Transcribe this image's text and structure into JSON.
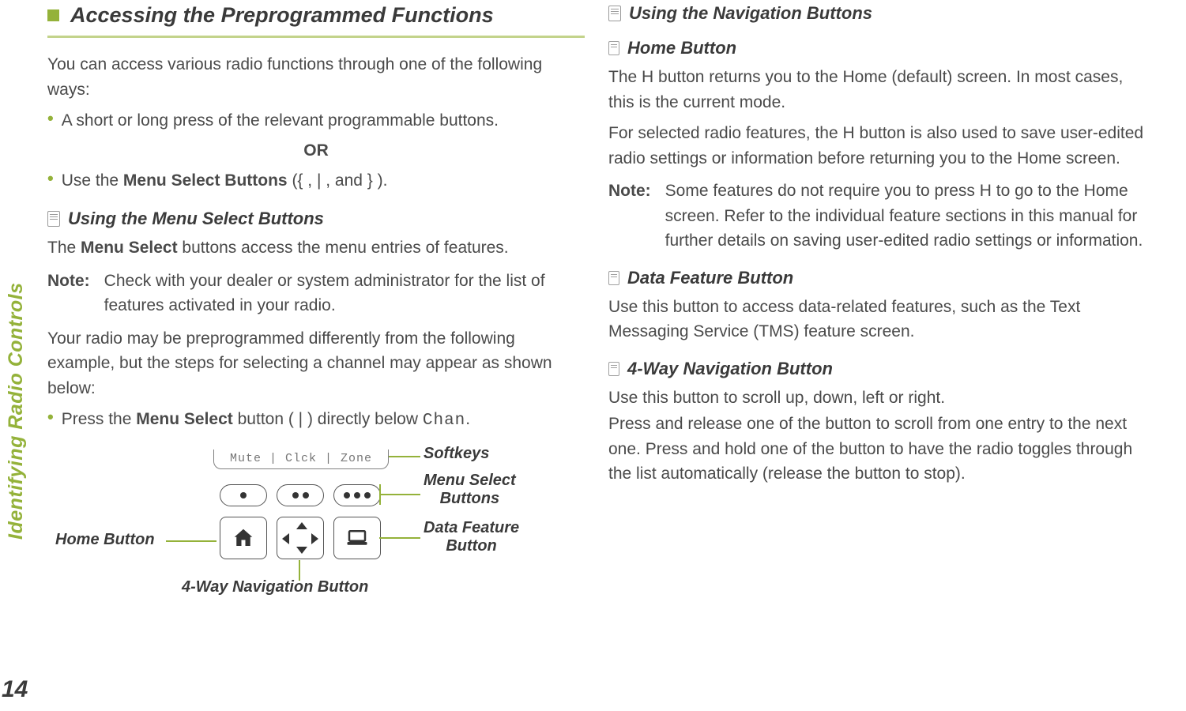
{
  "page": {
    "side_label": "Identifying Radio Controls",
    "number": "14"
  },
  "left": {
    "h1": "Accessing the Preprogrammed Functions",
    "intro": "You can access various radio functions through one of the following ways:",
    "bullet1": "A short or long press of the relevant programmable buttons.",
    "or": "OR",
    "bullet2_pre": "Use the ",
    "bullet2_bold": "Menu Select Buttons",
    "bullet2_post": " ({    , |    , and }    ).",
    "h2": "Using the Menu Select Buttons",
    "p1_pre": "The ",
    "p1_bold": "Menu Select",
    "p1_post": " buttons access the menu entries of features.",
    "note_label": "Note:",
    "note_body": "Check with your dealer or system administrator for the list of features activated in your radio.",
    "p2": "Your radio may be preprogrammed differently from the following example, but the steps for selecting a channel may appear as shown below:",
    "bullet3_pre": "Press the ",
    "bullet3_bold": "Menu Select",
    "bullet3_mid": " button ( |    ) directly below ",
    "bullet3_mono": "Chan",
    "bullet3_end": "."
  },
  "diagram": {
    "softkeys_text": "Mute | Clck | Zone",
    "label_softkeys": "Softkeys",
    "label_menuselect_l1": "Menu Select",
    "label_menuselect_l2": "Buttons",
    "label_datafeature_l1": "Data Feature",
    "label_datafeature_l2": "Button",
    "label_home": "Home Button",
    "label_nav": "4-Way Navigation Button"
  },
  "right": {
    "h2": "Using the Navigation Buttons",
    "home": {
      "h3": "Home Button",
      "p1_pre": "The ",
      "p1_key": "H",
      "p1_post": " button returns you to the Home (default) screen. In most cases, this is the current mode.",
      "p2_pre": "For selected radio features, the ",
      "p2_key": "H",
      "p2_post": " button is also used to save user-edited radio settings or information before returning you to the Home screen.",
      "note_label": "Note:",
      "note_pre": "Some features do not require you to press ",
      "note_key": "H",
      "note_post": " to go to the Home screen. Refer to the individual feature sections in this manual for further details on saving user-edited radio settings or information."
    },
    "dfb": {
      "h3": "Data Feature Button",
      "p": "Use this button to access data-related features, such as the Text Messaging Service (TMS) feature screen."
    },
    "nav": {
      "h3": "4-Way Navigation Button",
      "p1": "Use this button to scroll up, down, left or right.",
      "p2": "Press and release one of the button to scroll from one entry to the next one. Press and hold one of the button to have the radio toggles through the list automatically (release the button to stop)."
    }
  }
}
